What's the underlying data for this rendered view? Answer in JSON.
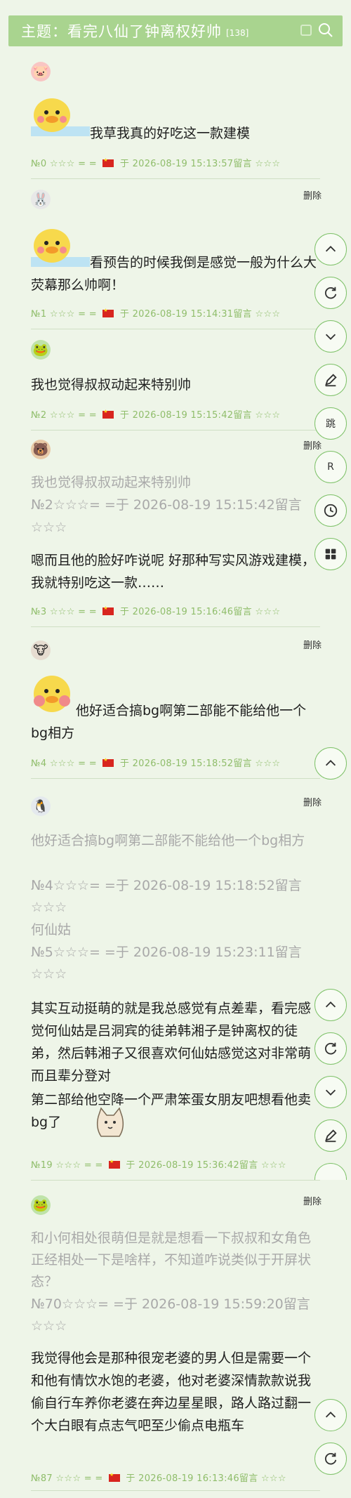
{
  "topic": {
    "title": "主题：看完八仙了钟离权好帅",
    "count": "[138]"
  },
  "delete_label": "删除",
  "stars": "☆☆☆",
  "posts": [
    {
      "id": "№0",
      "time": "2026-08-19 15:13:57",
      "avatar": "pig-avatar",
      "text": "我草我真的好吃这一款建模"
    },
    {
      "id": "№1",
      "time": "2026-08-19 15:14:31",
      "avatar": "rabbit-avatar",
      "text": "看预告的时候我倒是感觉一般为什么大荧幕那么帅啊！"
    },
    {
      "id": "№2",
      "time": "2026-08-19 15:15:42",
      "avatar": "frog-avatar",
      "text": "我也觉得叔叔动起来特别帅"
    },
    {
      "id": "№3",
      "time": "2026-08-19 15:16:46",
      "avatar": "bear-avatar",
      "quote_text": "我也觉得叔叔动起来特别帅",
      "quote_meta": "№2☆☆☆= =于 2026-08-19 15:15:42留言",
      "quote_stars": "☆☆☆",
      "text": "嗯而且他的脸好咋说呢 好那种写实风游戏建模，我就特别吃这一款……"
    },
    {
      "id": "№4",
      "time": "2026-08-19 15:18:52",
      "avatar": "cow-avatar",
      "text": "他好适合搞bg啊第二部能不能给他一个bg相方"
    },
    {
      "id": "№19",
      "time": "2026-08-19 15:36:42",
      "avatar": "penguin-avatar",
      "quote1_text": "他好适合搞bg啊第二部能不能给他一个bg相方",
      "quote1_meta": "№4☆☆☆= =于 2026-08-19 15:18:52留言",
      "quote1_stars": "☆☆☆",
      "quote2_text": "何仙姑",
      "quote2_meta": "№5☆☆☆= =于 2026-08-19 15:23:11留言",
      "quote2_stars": "☆☆☆",
      "text": "其实互动挺萌的就是我总感觉有点差辈，看完感觉何仙姑是吕洞宾的徒弟韩湘子是钟离权的徒弟，然后韩湘子又很喜欢何仙姑感觉这对非常萌而且辈分登对",
      "text2": "第二部给他空降一个严肃笨蛋女朋友吧想看他卖bg了"
    },
    {
      "id": "№87",
      "time": "2026-08-19 16:13:46",
      "avatar": "frog-avatar",
      "quote_text": "和小何相处很萌但是就是想看一下叔叔和女角色正经相处一下是啥样，不知道咋说类似于开屏状态？",
      "quote_meta": "№70☆☆☆= =于 2026-08-19 15:59:20留言☆☆☆",
      "text": "我觉得他会是那种很宠老婆的男人但是需要一个和他有情饮水饱的老婆，他对老婆深情款款说我偷自行车养你老婆在奔边星星眼，路人路过翻一个大白眼有点志气吧至少偷点电瓶车"
    }
  ],
  "side_buttons": {
    "jump": "跳",
    "refresh_r": "R"
  }
}
